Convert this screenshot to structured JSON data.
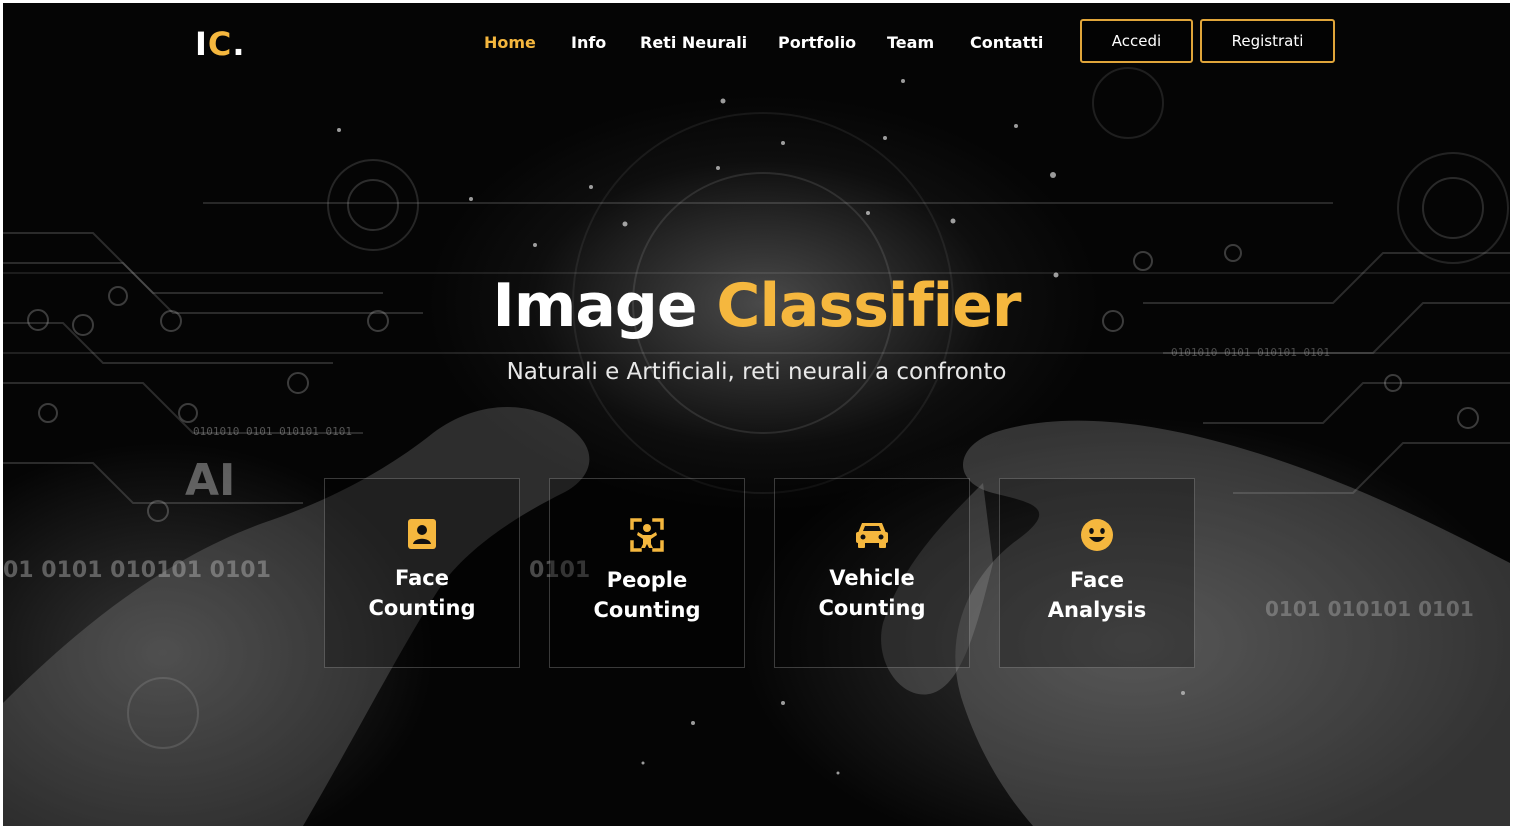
{
  "logo": {
    "main": "I",
    "accent": "C",
    "dot": "."
  },
  "nav": {
    "items": [
      {
        "label": "Home",
        "active": true
      },
      {
        "label": "Info",
        "active": false
      },
      {
        "label": "Reti Neurali",
        "active": false
      },
      {
        "label": "Portfolio",
        "active": false
      },
      {
        "label": "Team",
        "active": false
      },
      {
        "label": "Contatti",
        "active": false
      }
    ],
    "login_label": "Accedi",
    "register_label": "Registrati"
  },
  "hero": {
    "title_white": "Image",
    "title_accent": "Classifier",
    "subtitle": "Naturali e Artificiali, reti neurali a confronto"
  },
  "background_text": {
    "ai": "AI",
    "binary_left": "01 0101 010101 0101",
    "binary_center": "0101",
    "binary_right": "0101 010101 0101",
    "binary_small_left": "0101010 0101 010101 0101",
    "binary_small_right": "0101010 0101 010101 0101"
  },
  "cards": [
    {
      "line1": "Face",
      "line2": "Counting",
      "icon": "portrait-icon"
    },
    {
      "line1": "People",
      "line2": "Counting",
      "icon": "person-focus-icon"
    },
    {
      "line1": "Vehicle",
      "line2": "Counting",
      "icon": "car-icon"
    },
    {
      "line1": "Face",
      "line2": "Analysis",
      "icon": "smiley-icon"
    }
  ],
  "colors": {
    "accent": "#f5b73e",
    "background": "#050505",
    "button_border": "#e0a53a"
  }
}
